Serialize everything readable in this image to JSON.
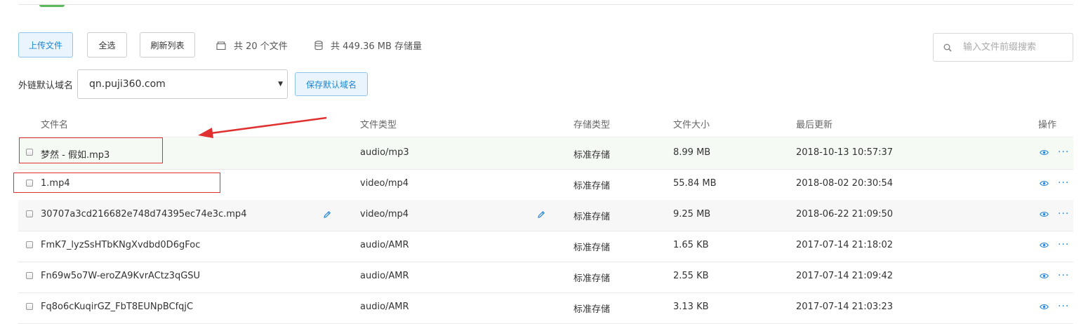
{
  "toolbar": {
    "upload_label": "上传文件",
    "select_all_label": "全选",
    "refresh_label": "刷新列表",
    "file_count_text": "共 20 个文件",
    "storage_text": "共 449.36 MB 存储量"
  },
  "search": {
    "placeholder": "输入文件前缀搜索",
    "icon": "search-icon"
  },
  "domain": {
    "label": "外链默认域名",
    "selected": "qn.puji360.com",
    "save_label": "保存默认域名"
  },
  "table": {
    "columns": {
      "name": "文件名",
      "type": "文件类型",
      "storage": "存储类型",
      "size": "文件大小",
      "updated": "最后更新",
      "actions": "操作"
    },
    "rows": [
      {
        "name": "梦然 - 假如.mp3",
        "type": "audio/mp3",
        "storage": "标准存储",
        "size": "8.99 MB",
        "updated": "2018-10-13 10:57:37"
      },
      {
        "name": "1.mp4",
        "type": "video/mp4",
        "storage": "标准存储",
        "size": "55.84 MB",
        "updated": "2018-08-02 20:30:54"
      },
      {
        "name": "30707a3cd216682e748d74395ec74e3c.mp4",
        "type": "video/mp4",
        "storage": "标准存储",
        "size": "9.25 MB",
        "updated": "2018-06-22 21:09:50"
      },
      {
        "name": "FmK7_lyzSsHTbKNgXvdbd0D6gFoc",
        "type": "audio/AMR",
        "storage": "标准存储",
        "size": "1.65 KB",
        "updated": "2017-07-14 21:18:02"
      },
      {
        "name": "Fn69w5o7W-eroZA9KvrACtz3qGSU",
        "type": "audio/AMR",
        "storage": "标准存储",
        "size": "2.55 KB",
        "updated": "2017-07-14 21:09:42"
      },
      {
        "name": "Fq8o6cKuqirGZ_FbT8EUNpBCfqjC",
        "type": "audio/AMR",
        "storage": "标准存储",
        "size": "3.13 KB",
        "updated": "2017-07-14 21:03:23"
      }
    ],
    "more_actions_label": "···"
  },
  "colors": {
    "accent": "#1c87d4",
    "annotation": "#e03030",
    "highlight_row": "#f5faf5"
  }
}
